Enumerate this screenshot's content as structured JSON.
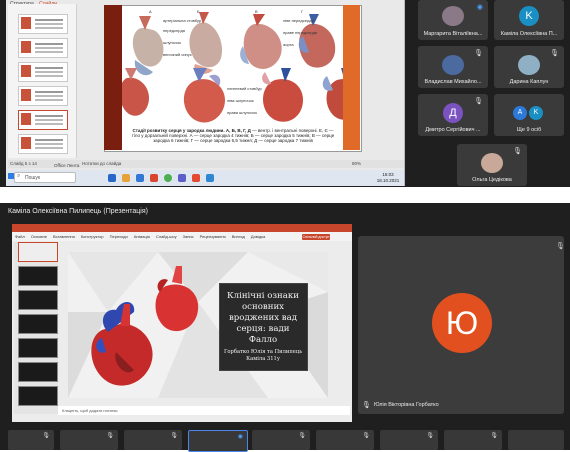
{
  "top_screen": {
    "ppt_tabs": [
      "Структура",
      "Слайди"
    ],
    "search_label": "Пошук",
    "office_label": "Office Лента",
    "status_left": "Слайд 5 з 14",
    "zoom": "80%",
    "notes_hint": "Нотатки до слайда",
    "clock_time": "15:03",
    "clock_date": "18.10.2021",
    "slide_caption_bold": "Стадії розвитку серця у зародка людини. А, Б, В, Г, Д",
    "slide_caption_rest": "— вентр. і вентральні поверхні. Е, Є — тіло у дорзальній поверхні. А — серце зародка 4 тижнів; Б — серце зародка 5 тижнів; В — серце зародка 6 тижнів; Г — серце зародка 6,5 тижня; Д — серце зародка 7 тижнів",
    "labels": [
      "артеріальна стовбур",
      "передсердя",
      "шлуночок",
      "венозний синус",
      "ліве передсердя",
      "праве передсердя",
      "аорта",
      "легеневий стовбур",
      "ліва шлуночок",
      "права шлуночок"
    ],
    "participants": [
      {
        "name": "Маргарита Віталіївна...",
        "initial": "",
        "color": "#3c3c3c",
        "photo": true
      },
      {
        "name": "Камілa Олексіївна П...",
        "initial": "K",
        "color": "#1a8fc4",
        "photo": false
      },
      {
        "name": "Владислав Михайло...",
        "initial": "",
        "color": "#3c3c3c",
        "photo": true
      },
      {
        "name": "Дарина Каплун",
        "initial": "",
        "color": "#3c3c3c",
        "photo": true
      },
      {
        "name": "Дмитро Сергійович ...",
        "initial": "Д",
        "color": "#7b53c1",
        "photo": false
      },
      {
        "name": "Ще 9 осіб",
        "initial": "A",
        "color": "#2b7ad9",
        "photo": false
      },
      {
        "name": "Ольга Цедікова",
        "initial": "",
        "color": "#3c3c3c",
        "photo": true
      }
    ]
  },
  "bottom_screen": {
    "presenter_title": "Каміла Олексіївна Пилипець (Презентація)",
    "menu": [
      "Файл",
      "Основне",
      "Вставлення",
      "Конструктор",
      "Переходи",
      "Анімація",
      "Слайд-шоу",
      "Запис",
      "Рецензування",
      "Вигляд",
      "Довідка"
    ],
    "share_label": "Спільний доступ",
    "slide_title": "Клінічні ознаки основних вроджених вад серця: вади Фалло",
    "authors": "Горбатко Юлія та Пилипець Каміла 311у",
    "notes_hint": "Клацніть, щоб додати нотатки",
    "big_initial": "Ю",
    "big_name": "Юлія Вікторівна Горбатко"
  },
  "colors": {
    "accent_red": "#c8472c",
    "avatar_orange": "#e3501f",
    "avatar_blue": "#1a8fc4",
    "avatar_purple": "#7b53c1"
  }
}
